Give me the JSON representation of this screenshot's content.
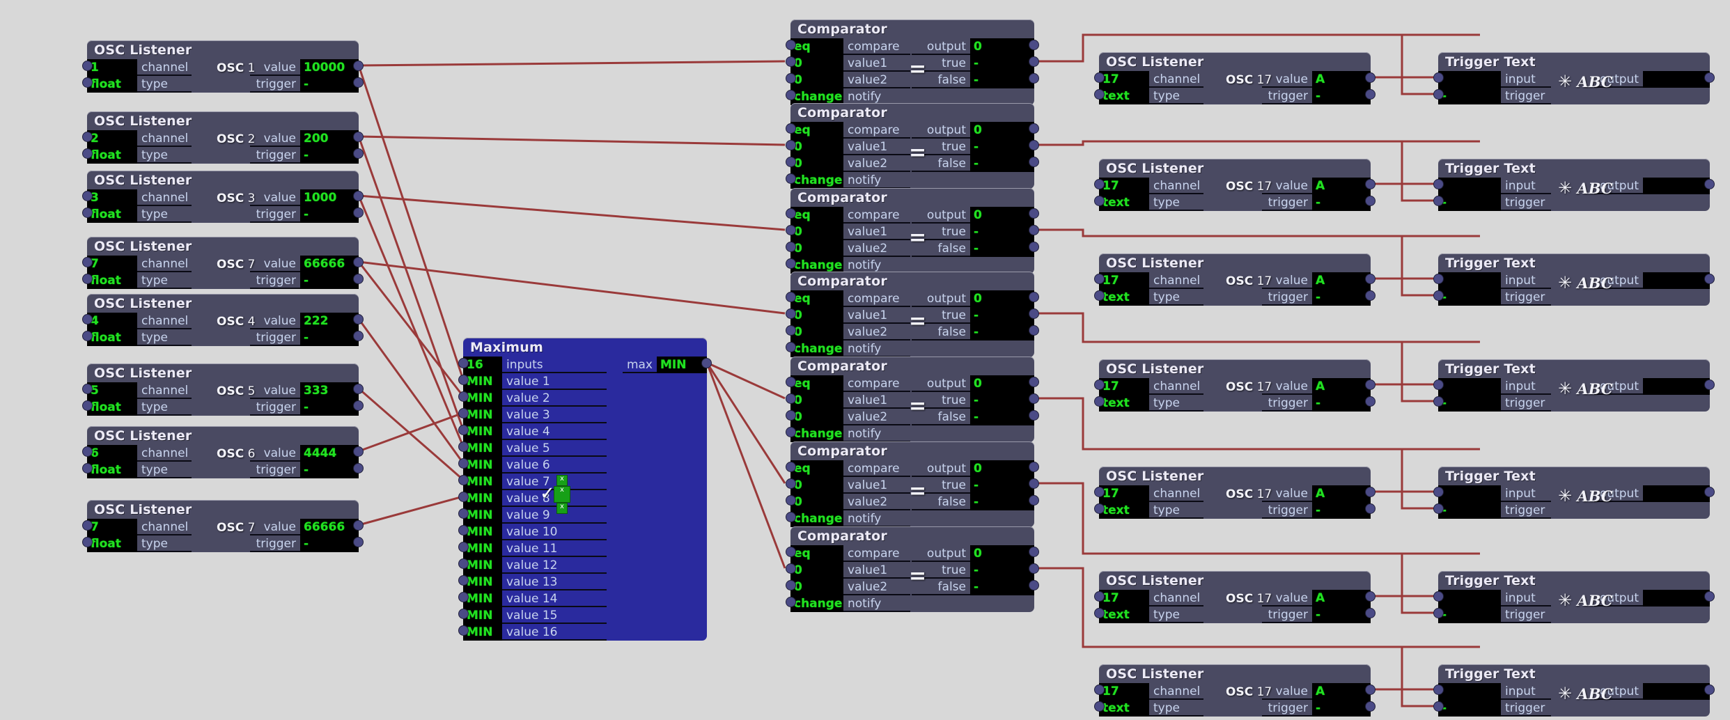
{
  "canvas": {
    "background": "#d8d8d8",
    "node_color": "#4a4a62",
    "node_selected_color": "#2a2a9e",
    "field_color": "#000000",
    "value_text_color": "#22e022",
    "label_text_color": "#c8d4ee",
    "wire_color": "#9a3a3a"
  },
  "labels": {
    "channel": "channel",
    "type": "type",
    "value": "value",
    "trigger": "trigger",
    "compare": "compare",
    "value1": "value1",
    "value2": "value2",
    "notify": "notify",
    "output": "output",
    "true": "true",
    "false": "false",
    "inputs": "inputs",
    "max": "max",
    "input": "input"
  },
  "icons": {
    "osc": "OSC",
    "equals": "=",
    "abc": "ABC",
    "star": "✳",
    "checkmark": "✓"
  },
  "titles": {
    "osc_listener": "OSC Listener",
    "comparator": "Comparator",
    "trigger_text": "Trigger Text",
    "maximum": "Maximum"
  },
  "osc_sources": [
    {
      "title": "OSC Listener",
      "channel": "1",
      "type": "float",
      "value": "10000",
      "trigger": "-",
      "badge": "1"
    },
    {
      "title": "OSC Listener",
      "channel": "2",
      "type": "float",
      "value": "200",
      "trigger": "-",
      "badge": "2"
    },
    {
      "title": "OSC Listener",
      "channel": "3",
      "type": "float",
      "value": "1000",
      "trigger": "-",
      "badge": "3"
    },
    {
      "title": "OSC Listener",
      "channel": "7",
      "type": "float",
      "value": "66666",
      "trigger": "-",
      "badge": "7"
    },
    {
      "title": "OSC Listener",
      "channel": "4",
      "type": "float",
      "value": "222",
      "trigger": "-",
      "badge": "4"
    },
    {
      "title": "OSC Listener",
      "channel": "5",
      "type": "float",
      "value": "333",
      "trigger": "-",
      "badge": "5"
    },
    {
      "title": "OSC Listener",
      "channel": "6",
      "type": "float",
      "value": "4444",
      "trigger": "-",
      "badge": "6"
    },
    {
      "title": "OSC Listener",
      "channel": "7",
      "type": "float",
      "value": "66666",
      "trigger": "-",
      "badge": "7"
    }
  ],
  "maximum": {
    "title": "Maximum",
    "inputs_count": "16",
    "inputs_label": "inputs",
    "max_label": "max",
    "max_value": "MIN",
    "selected": true,
    "values": [
      {
        "label": "value 1",
        "value": "MIN"
      },
      {
        "label": "value 2",
        "value": "MIN"
      },
      {
        "label": "value 3",
        "value": "MIN"
      },
      {
        "label": "value 4",
        "value": "MIN"
      },
      {
        "label": "value 5",
        "value": "MIN"
      },
      {
        "label": "value 6",
        "value": "MIN"
      },
      {
        "label": "value 7",
        "value": "MIN"
      },
      {
        "label": "value 8",
        "value": "MIN"
      },
      {
        "label": "value 9",
        "value": "MIN"
      },
      {
        "label": "value 10",
        "value": "MIN"
      },
      {
        "label": "value 11",
        "value": "MIN"
      },
      {
        "label": "value 12",
        "value": "MIN"
      },
      {
        "label": "value 13",
        "value": "MIN"
      },
      {
        "label": "value 14",
        "value": "MIN"
      },
      {
        "label": "value 15",
        "value": "MIN"
      },
      {
        "label": "value 16",
        "value": "MIN"
      }
    ]
  },
  "comparators": [
    {
      "title": "Comparator",
      "compare": "eq",
      "value1": "0",
      "value2": "0",
      "notify": "change",
      "output": "0",
      "true": "-",
      "false": "-"
    },
    {
      "title": "Comparator",
      "compare": "eq",
      "value1": "0",
      "value2": "0",
      "notify": "change",
      "output": "0",
      "true": "-",
      "false": "-"
    },
    {
      "title": "Comparator",
      "compare": "eq",
      "value1": "0",
      "value2": "0",
      "notify": "change",
      "output": "0",
      "true": "-",
      "false": "-"
    },
    {
      "title": "Comparator",
      "compare": "eq",
      "value1": "0",
      "value2": "0",
      "notify": "change",
      "output": "0",
      "true": "-",
      "false": "-"
    },
    {
      "title": "Comparator",
      "compare": "eq",
      "value1": "0",
      "value2": "0",
      "notify": "change",
      "output": "0",
      "true": "-",
      "false": "-"
    },
    {
      "title": "Comparator",
      "compare": "eq",
      "value1": "0",
      "value2": "0",
      "notify": "change",
      "output": "0",
      "true": "-",
      "false": "-"
    },
    {
      "title": "Comparator",
      "compare": "eq",
      "value1": "0",
      "value2": "0",
      "notify": "change",
      "output": "0",
      "true": "-",
      "false": "-"
    }
  ],
  "osc_outs": [
    {
      "title": "OSC Listener",
      "channel": "17",
      "type": "text",
      "value": "A",
      "trigger": "-",
      "badge": "17"
    },
    {
      "title": "OSC Listener",
      "channel": "17",
      "type": "text",
      "value": "A",
      "trigger": "-",
      "badge": "17"
    },
    {
      "title": "OSC Listener",
      "channel": "17",
      "type": "text",
      "value": "A",
      "trigger": "-",
      "badge": "17"
    },
    {
      "title": "OSC Listener",
      "channel": "17",
      "type": "text",
      "value": "A",
      "trigger": "-",
      "badge": "17"
    },
    {
      "title": "OSC Listener",
      "channel": "17",
      "type": "text",
      "value": "A",
      "trigger": "-",
      "badge": "17"
    },
    {
      "title": "OSC Listener",
      "channel": "17",
      "type": "text",
      "value": "A",
      "trigger": "-",
      "badge": "17"
    },
    {
      "title": "OSC Listener",
      "channel": "17",
      "type": "text",
      "value": "A",
      "trigger": "-",
      "badge": "17"
    }
  ],
  "trigger_texts": [
    {
      "title": "Trigger Text",
      "input": "",
      "trigger": "-",
      "output": ""
    },
    {
      "title": "Trigger Text",
      "input": "",
      "trigger": "-",
      "output": ""
    },
    {
      "title": "Trigger Text",
      "input": "",
      "trigger": "-",
      "output": ""
    },
    {
      "title": "Trigger Text",
      "input": "",
      "trigger": "-",
      "output": ""
    },
    {
      "title": "Trigger Text",
      "input": "",
      "trigger": "-",
      "output": ""
    },
    {
      "title": "Trigger Text",
      "input": "",
      "trigger": "-",
      "output": ""
    },
    {
      "title": "Trigger Text",
      "input": "",
      "trigger": "-",
      "output": ""
    }
  ]
}
